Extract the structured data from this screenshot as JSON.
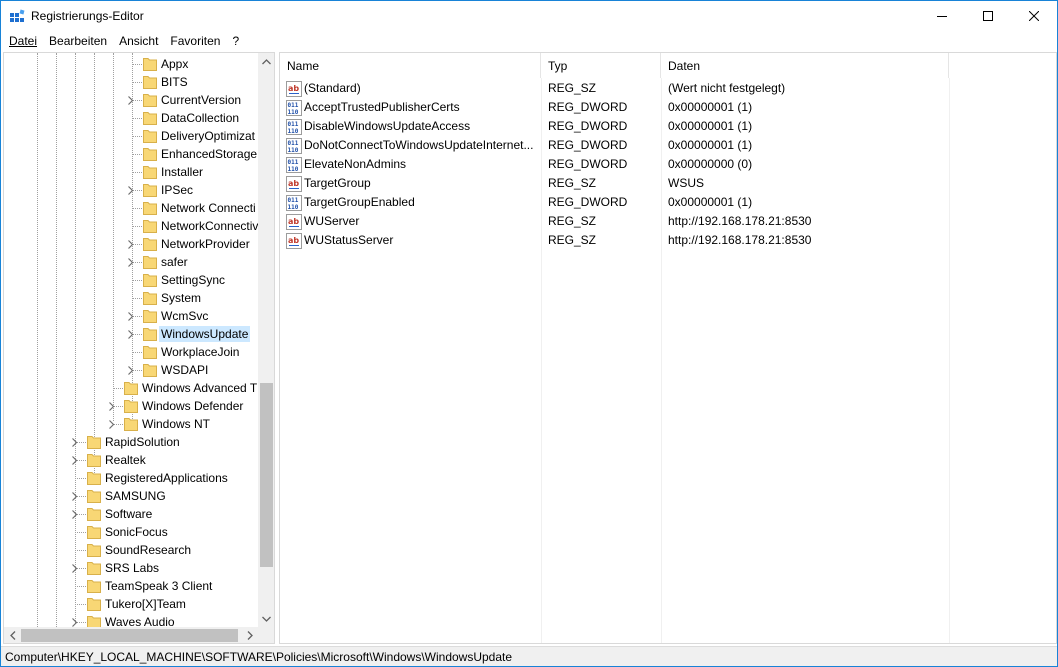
{
  "window": {
    "title": "Registrierungs-Editor"
  },
  "menu": [
    "Datei",
    "Bearbeiten",
    "Ansicht",
    "Favoriten",
    "?"
  ],
  "tree": {
    "items": [
      {
        "label": "Appx",
        "expandable": false
      },
      {
        "label": "BITS",
        "expandable": false
      },
      {
        "label": "CurrentVersion",
        "expandable": true
      },
      {
        "label": "DataCollection",
        "expandable": false
      },
      {
        "label": "DeliveryOptimizat",
        "expandable": false
      },
      {
        "label": "EnhancedStorageD",
        "expandable": false
      },
      {
        "label": "Installer",
        "expandable": false
      },
      {
        "label": "IPSec",
        "expandable": true
      },
      {
        "label": "Network Connecti",
        "expandable": false
      },
      {
        "label": "NetworkConnectiv",
        "expandable": false
      },
      {
        "label": "NetworkProvider",
        "expandable": true
      },
      {
        "label": "safer",
        "expandable": true
      },
      {
        "label": "SettingSync",
        "expandable": false
      },
      {
        "label": "System",
        "expandable": false
      },
      {
        "label": "WcmSvc",
        "expandable": true
      },
      {
        "label": "WindowsUpdate",
        "expandable": true,
        "selected": true
      },
      {
        "label": "WorkplaceJoin",
        "expandable": false
      },
      {
        "label": "WSDAPI",
        "expandable": true
      },
      {
        "label": "Windows Advanced T",
        "expandable": false
      },
      {
        "label": "Windows Defender",
        "expandable": true
      },
      {
        "label": "Windows NT",
        "expandable": true
      },
      {
        "label": "RapidSolution",
        "expandable": true
      },
      {
        "label": "Realtek",
        "expandable": true
      },
      {
        "label": "RegisteredApplications",
        "expandable": false
      },
      {
        "label": "SAMSUNG",
        "expandable": true
      },
      {
        "label": "Software",
        "expandable": true
      },
      {
        "label": "SonicFocus",
        "expandable": false
      },
      {
        "label": "SoundResearch",
        "expandable": false
      },
      {
        "label": "SRS Labs",
        "expandable": true
      },
      {
        "label": "TeamSpeak 3 Client",
        "expandable": false
      },
      {
        "label": "Tukero[X]Team",
        "expandable": false
      },
      {
        "label": "Waves Audio",
        "expandable": true
      }
    ]
  },
  "list": {
    "columns": [
      "Name",
      "Typ",
      "Daten"
    ],
    "rows": [
      {
        "name": "(Standard)",
        "type": "REG_SZ",
        "data": "(Wert nicht festgelegt)",
        "icon": "string-value-icon"
      },
      {
        "name": "AcceptTrustedPublisherCerts",
        "type": "REG_DWORD",
        "data": "0x00000001 (1)",
        "icon": "binary-value-icon"
      },
      {
        "name": "DisableWindowsUpdateAccess",
        "type": "REG_DWORD",
        "data": "0x00000001 (1)",
        "icon": "binary-value-icon"
      },
      {
        "name": "DoNotConnectToWindowsUpdateInternet...",
        "type": "REG_DWORD",
        "data": "0x00000001 (1)",
        "icon": "binary-value-icon"
      },
      {
        "name": "ElevateNonAdmins",
        "type": "REG_DWORD",
        "data": "0x00000000 (0)",
        "icon": "binary-value-icon"
      },
      {
        "name": "TargetGroup",
        "type": "REG_SZ",
        "data": "WSUS",
        "icon": "string-value-icon"
      },
      {
        "name": "TargetGroupEnabled",
        "type": "REG_DWORD",
        "data": "0x00000001 (1)",
        "icon": "binary-value-icon"
      },
      {
        "name": "WUServer",
        "type": "REG_SZ",
        "data": "http://192.168.178.21:8530",
        "icon": "string-value-icon"
      },
      {
        "name": "WUStatusServer",
        "type": "REG_SZ",
        "data": "http://192.168.178.21:8530",
        "icon": "string-value-icon"
      }
    ]
  },
  "status": {
    "path": "Computer\\HKEY_LOCAL_MACHINE\\SOFTWARE\\Policies\\Microsoft\\Windows\\WindowsUpdate"
  },
  "colors": {
    "selection": "#cce8ff",
    "window_border": "#1883d7",
    "folder": "#f8d775"
  }
}
